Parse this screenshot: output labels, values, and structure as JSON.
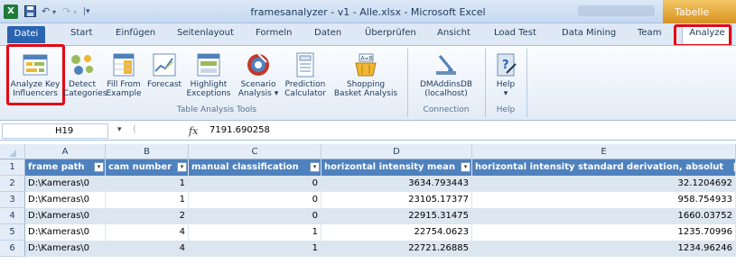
{
  "window": {
    "title": "framesanalyzer - v1 - Alle.xlsx - Microsoft Excel",
    "context_tab": "Tabelle",
    "logo": "X",
    "qat_icons": [
      "save-icon",
      "undo-icon",
      "redo-icon",
      "customize-qat-icon"
    ]
  },
  "tabs": [
    "Datei",
    "Start",
    "Einfügen",
    "Seitenlayout",
    "Formeln",
    "Daten",
    "Überprüfen",
    "Ansicht",
    "Load Test",
    "Data Mining",
    "Team",
    "Analyze"
  ],
  "ribbon": {
    "buttons": [
      {
        "line1": "Analyze Key",
        "line2": "Influencers",
        "icon": "key-influencers-icon"
      },
      {
        "line1": "Detect",
        "line2": "Categories",
        "icon": "detect-categories-icon"
      },
      {
        "line1": "Fill From",
        "line2": "Example",
        "icon": "fill-from-example-icon"
      },
      {
        "line1": "Forecast",
        "line2": "",
        "icon": "forecast-icon"
      },
      {
        "line1": "Highlight",
        "line2": "Exceptions",
        "icon": "highlight-exceptions-icon"
      },
      {
        "line1": "Scenario",
        "line2": "Analysis ▾",
        "icon": "scenario-analysis-icon"
      },
      {
        "line1": "Prediction",
        "line2": "Calculator",
        "icon": "prediction-calculator-icon"
      },
      {
        "line1": "Shopping",
        "line2": "Basket Analysis",
        "icon": "shopping-basket-icon"
      },
      {
        "line1": "DMAddinsDB",
        "line2": "(localhost)",
        "icon": "connection-icon"
      },
      {
        "line1": "Help",
        "line2": "▾",
        "icon": "help-icon"
      }
    ],
    "groups": [
      "Table Analysis Tools",
      "Connection",
      "Help"
    ]
  },
  "formula_bar": {
    "name_box": "H19",
    "fx": "fx",
    "value": "7191.690258"
  },
  "sheet": {
    "columns": [
      "A",
      "B",
      "C",
      "D",
      "E"
    ],
    "rows": [
      "1",
      "2",
      "3",
      "4",
      "5",
      "6"
    ],
    "headers": [
      "frame path",
      "cam number",
      "manual classification",
      "horizontal intensity mean",
      "horizontal intensity standard derivation, absolut"
    ],
    "data": [
      [
        "D:\\Kameras\\0",
        "1",
        "0",
        "3634.793443",
        "32.1204692"
      ],
      [
        "D:\\Kameras\\0",
        "1",
        "0",
        "23105.17377",
        "958.754933"
      ],
      [
        "D:\\Kameras\\0",
        "2",
        "0",
        "22915.31475",
        "1660.03752"
      ],
      [
        "D:\\Kameras\\0",
        "4",
        "1",
        "22754.0623",
        "1235.70996"
      ],
      [
        "D:\\Kameras\\0",
        "4",
        "1",
        "22721.26885",
        "1234.96246"
      ]
    ]
  },
  "colors": {
    "accent_red": "#e30613",
    "table_header": "#4f81bd",
    "band": "#dce6f1",
    "file_tab": "#2a64b0"
  }
}
